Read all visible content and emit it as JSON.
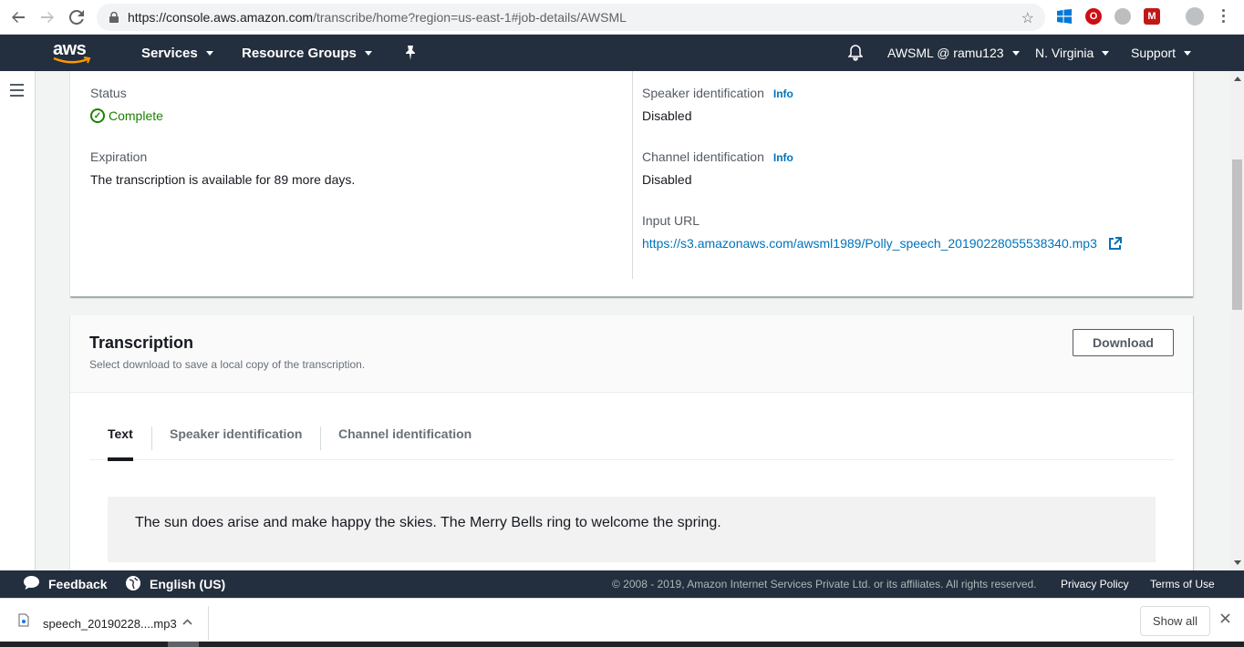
{
  "browser": {
    "url_host": "https://console.aws.amazon.com",
    "url_path": "/transcribe/home?region=us-east-1#job-details/AWSML"
  },
  "aws_nav": {
    "logo_text": "aws",
    "services": "Services",
    "resource_groups": "Resource Groups",
    "account": "AWSML @ ramu123",
    "region": "N. Virginia",
    "support": "Support"
  },
  "details": {
    "status_label": "Status",
    "status_value": "Complete",
    "expiration_label": "Expiration",
    "expiration_value": "The transcription is available for 89 more days.",
    "speaker_label": "Speaker identification",
    "speaker_info": "Info",
    "speaker_value": "Disabled",
    "channel_label": "Channel identification",
    "channel_info": "Info",
    "channel_value": "Disabled",
    "input_url_label": "Input URL",
    "input_url_value": "https://s3.amazonaws.com/awsml1989/Polly_speech_20190228055538340.mp3"
  },
  "transcription": {
    "title": "Transcription",
    "description": "Select download to save a local copy of the transcription.",
    "download_button": "Download",
    "tabs": [
      {
        "label": "Text",
        "active": true
      },
      {
        "label": "Speaker identification",
        "active": false
      },
      {
        "label": "Channel identification",
        "active": false
      }
    ],
    "text": "The sun does arise and make happy the skies. The Merry Bells ring to welcome the spring."
  },
  "footer": {
    "feedback": "Feedback",
    "language": "English (US)",
    "copyright": "© 2008 - 2019, Amazon Internet Services Private Ltd. or its affiliates. All rights reserved.",
    "privacy": "Privacy Policy",
    "terms": "Terms of Use"
  },
  "download_shelf": {
    "file_name": "speech_20190228....mp3",
    "show_all": "Show all"
  },
  "colors": {
    "aws_nav": "#232f3e",
    "aws_orange": "#ff9900",
    "link": "#0073bb",
    "success": "#1d8102"
  }
}
